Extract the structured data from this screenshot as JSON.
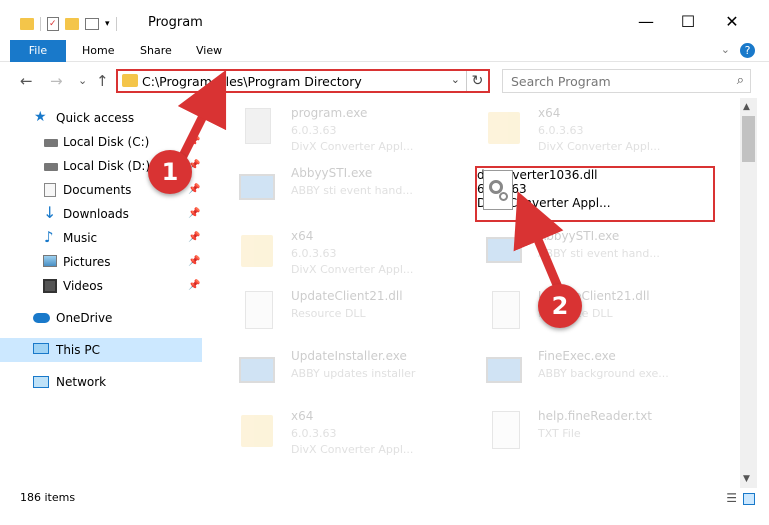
{
  "window": {
    "title": "Program",
    "minimize": "—",
    "maximize": "☐",
    "close": "✕"
  },
  "ribbon": {
    "tabs": [
      "File",
      "Home",
      "Share",
      "View"
    ],
    "expand": "⌄",
    "help": "?"
  },
  "address": {
    "path": "C:\\Program Files\\Program Directory",
    "dropdown": "⌄",
    "refresh": "↻"
  },
  "search": {
    "placeholder": "Search Program",
    "icon": "⌕"
  },
  "nav": {
    "back": "←",
    "forward": "→",
    "recent": "⌄",
    "up": "↑"
  },
  "sidebar": {
    "items": [
      {
        "label": "Quick access",
        "icon": "star-icon",
        "pinned": false
      },
      {
        "label": "Local Disk (C:)",
        "icon": "drive-icon",
        "pinned": true
      },
      {
        "label": "Local Disk (D:)",
        "icon": "drive-icon",
        "pinned": true
      },
      {
        "label": "Documents",
        "icon": "documents-icon",
        "pinned": true
      },
      {
        "label": "Downloads",
        "icon": "downloads-icon",
        "pinned": true
      },
      {
        "label": "Music",
        "icon": "music-icon",
        "pinned": true
      },
      {
        "label": "Pictures",
        "icon": "pictures-icon",
        "pinned": true
      },
      {
        "label": "Videos",
        "icon": "videos-icon",
        "pinned": true
      },
      {
        "label": "OneDrive",
        "icon": "cloud-icon",
        "pinned": false
      },
      {
        "label": "This PC",
        "icon": "pc-icon",
        "pinned": false,
        "selected": true
      },
      {
        "label": "Network",
        "icon": "network-icon",
        "pinned": false
      }
    ],
    "pin": "📌"
  },
  "files": [
    {
      "name": "program.exe",
      "version": "6.0.3.63",
      "desc": "DivX Converter Appl...",
      "icon": "exe-icon"
    },
    {
      "name": "x64",
      "version": "6.0.3.63",
      "desc": "DivX Converter Appl...",
      "icon": "folder-icon"
    },
    {
      "name": "AbbyySTI.exe",
      "version": "",
      "desc": "ABBY sti event hand...",
      "icon": "window-icon"
    },
    {
      "name": "dsconverter1036.dll",
      "version": "6.0.3.63",
      "desc": "DivX Converter Appl...",
      "icon": "dll-gear-icon"
    },
    {
      "name": "x64",
      "version": "6.0.3.63",
      "desc": "DivX Converter Appl...",
      "icon": "folder-icon"
    },
    {
      "name": "AbbyySTI.exe",
      "version": "",
      "desc": "ABBY sti event hand...",
      "icon": "window-icon"
    },
    {
      "name": "UpdateClient21.dll",
      "version": "",
      "desc": "Resource DLL",
      "icon": "dll-gear-icon"
    },
    {
      "name": "UpdateClient21.dll",
      "version": "",
      "desc": "Resource DLL",
      "icon": "dll-gear-icon"
    },
    {
      "name": "UpdateInstaller.exe",
      "version": "",
      "desc": "ABBY updates installer",
      "icon": "window-icon"
    },
    {
      "name": "FineExec.exe",
      "version": "",
      "desc": "ABBY background exe...",
      "icon": "window-icon"
    },
    {
      "name": "x64",
      "version": "6.0.3.63",
      "desc": "DivX Converter Appl...",
      "icon": "folder-icon"
    },
    {
      "name": "help.fineReader.txt",
      "version": "",
      "desc": "TXT File",
      "icon": "txt-icon"
    }
  ],
  "status": {
    "count": "186 items"
  },
  "annotations": {
    "step1": "1",
    "step2": "2"
  },
  "colors": {
    "accent": "#1979ca",
    "highlight": "#d93333",
    "selected": "#cce8ff",
    "folder": "#f4c54a"
  }
}
